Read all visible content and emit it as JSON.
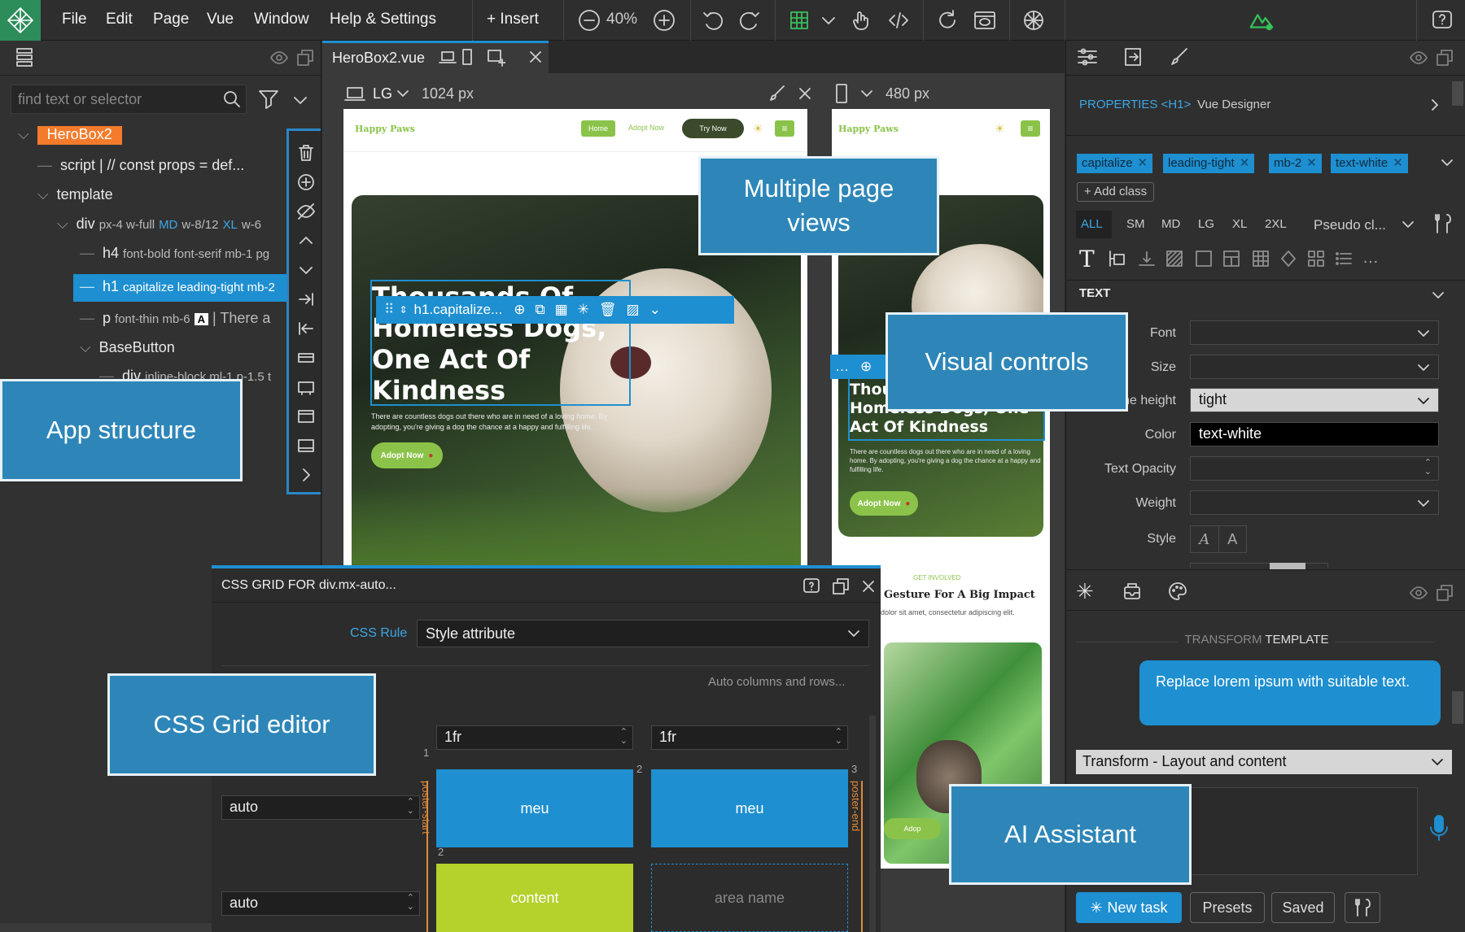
{
  "menubar": {
    "items": [
      "File",
      "Edit",
      "Page",
      "Vue",
      "Window",
      "Help & Settings"
    ],
    "insert_label": "+ Insert",
    "zoom": "40%"
  },
  "left": {
    "search_placeholder": "find text or selector",
    "root": "HeroBox2",
    "script": "script | // const props = def...",
    "template": "template",
    "div_tag": "div",
    "div_attrs_a": "px-4 w-full",
    "div_md": "MD",
    "div_attrs_b": "w-8/12",
    "div_xl": "XL",
    "div_attrs_c": "w-6",
    "h4_tag": "h4",
    "h4_attrs": "font-bold font-serif mb-1 pg",
    "h1_tag": "h1",
    "h1_attrs": "capitalize leading-tight mb-2",
    "p_tag": "p",
    "p_attrs": "font-thin mb-6",
    "p_badge": "A",
    "p_text": "| There a",
    "basebutton": "BaseButton",
    "div2_tag": "div",
    "div2_attrs": "inline-block ml-1 p-1.5 t"
  },
  "doc": {
    "tab": "HeroBox2.vue"
  },
  "vp_lg": {
    "label": "LG",
    "width": "1024 px"
  },
  "vp_sm": {
    "width": "480 px"
  },
  "page": {
    "logo": "Happy Paws",
    "nav_home": "Home",
    "nav_adopt": "Adopt Now",
    "nav_try": "Try Now",
    "hero_title": "Thousands Of Homeless Dogs, One Act Of Kindness",
    "hero_title_sm": "Thousands Of Homeless Dogs, One Act Of Kindness",
    "hero_text": "There are countless dogs out there who are in need of a loving home. By adopting, you're giving a dog the chance at a happy and fulfilling life.",
    "hero_text_sm": "There are countless dogs out there who are in need of a loving home. By adopting, you're giving a dog the chance at a happy and fulfilling life.",
    "adopt_btn": "Adopt Now",
    "got_involved": "GET INVOLVED",
    "gesture": "Gesture For A Big Impact",
    "lorem": "dolor sit amet, consectetur adipiscing elit.",
    "adopt_small": "Adop"
  },
  "selection": {
    "label": "h1.capitalize..."
  },
  "callouts": {
    "multi": "Multiple page views",
    "visual": "Visual controls",
    "app": "App structure",
    "grid": "CSS Grid editor",
    "ai": "AI Assistant"
  },
  "grid": {
    "title": "CSS GRID FOR div.mx-auto...",
    "rule_label": "CSS Rule",
    "rule_value": "Style attribute",
    "auto_hint": "Auto columns and rows...",
    "col1": "1fr",
    "col2": "1fr",
    "row1": "auto",
    "row2": "auto",
    "line1": "1",
    "line2": "2",
    "line3": "3",
    "rline2": "2",
    "start_label": "poster-start",
    "end_label": "poster-end",
    "cell_a": "meu",
    "cell_b": "meu",
    "cell_c": "content",
    "cell_d": "area name"
  },
  "right": {
    "properties_label": "PROPERTIES <H1>",
    "designer": "Vue Designer",
    "classes": [
      "capitalize",
      "leading-tight",
      "mb-2",
      "text-white"
    ],
    "add_class": "+ Add class",
    "breakpoints": [
      "ALL",
      "SM",
      "MD",
      "LG",
      "XL",
      "2XL"
    ],
    "pseudo": "Pseudo cl...",
    "section": "TEXT",
    "font_label": "Font",
    "size_label": "Size",
    "lh_label": "Line height",
    "lh_value": "tight",
    "color_label": "Color",
    "color_value": "text-white",
    "opacity_label": "Text Opacity",
    "weight_label": "Weight",
    "style_label": "Style",
    "transform_a": "TRANSFORM",
    "transform_b": "TEMPLATE",
    "bubble": "Replace lorem ipsum with suitable text.",
    "select_value": "Transform - Layout and content",
    "new_task": "New task",
    "presets": "Presets",
    "saved": "Saved"
  },
  "colors": {
    "accent": "#1e8fd0",
    "brand_orange": "#f47b2b",
    "page_green": "#8bc34a",
    "callout": "#2e86b8"
  }
}
